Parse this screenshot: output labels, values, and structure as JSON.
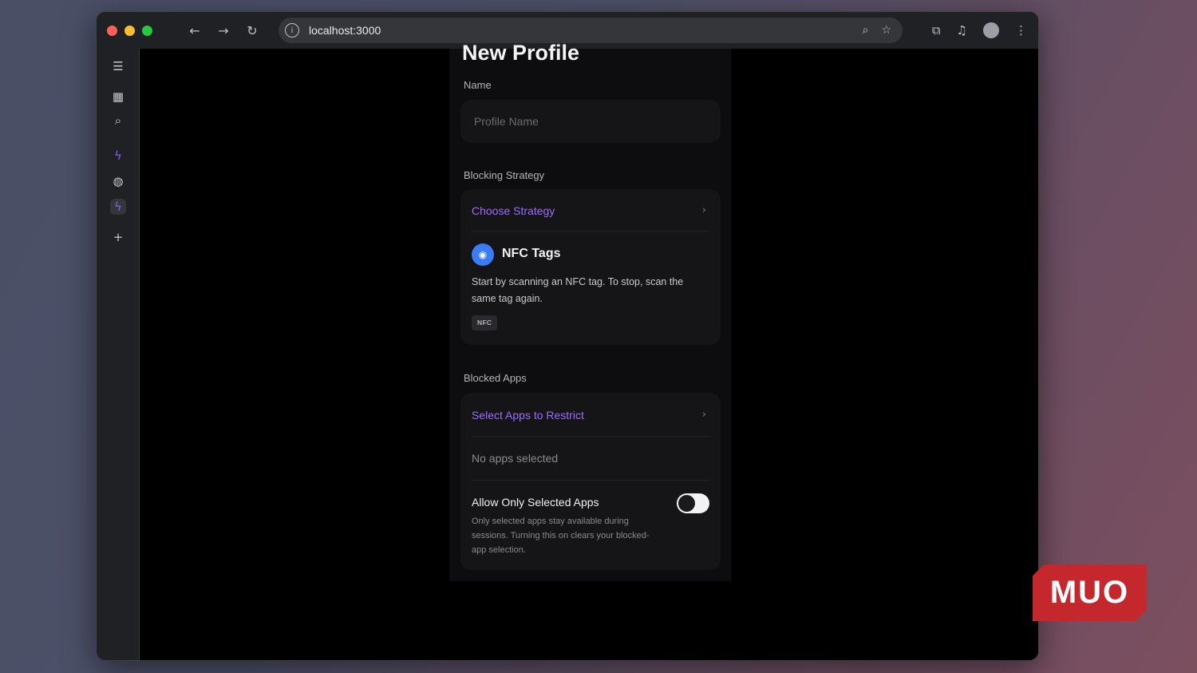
{
  "browser": {
    "url": "localhost:3000"
  },
  "page": {
    "title": "New Profile"
  },
  "name_section": {
    "label": "Name",
    "placeholder": "Profile Name"
  },
  "strategy_section": {
    "label": "Blocking Strategy",
    "choose_label": "Choose Strategy",
    "selected": {
      "title": "NFC Tags",
      "description": "Start by scanning an NFC tag. To stop, scan the same tag again.",
      "tag": "NFC"
    }
  },
  "apps_section": {
    "label": "Blocked Apps",
    "select_label": "Select Apps to Restrict",
    "status": "No apps selected",
    "toggle_label": "Allow Only Selected Apps",
    "toggle_desc": "Only selected apps stay available during sessions. Turning this on clears your blocked-app selection."
  },
  "watermark": {
    "text": "MUO"
  }
}
